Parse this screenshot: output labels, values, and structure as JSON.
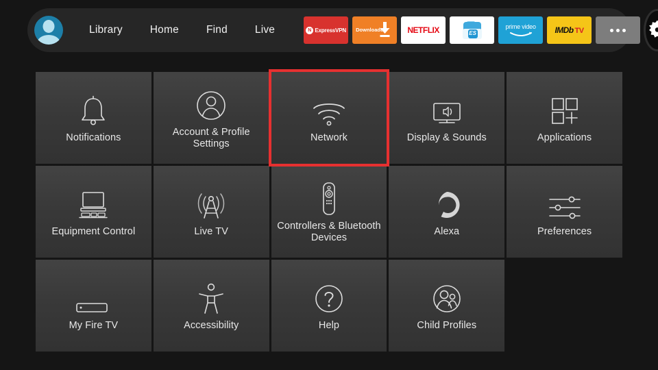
{
  "topbar": {
    "avatar_name": "profile-avatar",
    "nav": [
      {
        "label": "Library"
      },
      {
        "label": "Home"
      },
      {
        "label": "Find"
      },
      {
        "label": "Live"
      }
    ],
    "apps": [
      {
        "name": "expressvpn",
        "label": "ExpressVPN",
        "bg": "#d8322e"
      },
      {
        "name": "downloader",
        "label": "Downloader",
        "bg": "#f08026"
      },
      {
        "name": "netflix",
        "label": "NETFLIX",
        "bg": "#ffffff"
      },
      {
        "name": "es-file-explorer",
        "label": "ES",
        "bg": "#ffffff"
      },
      {
        "name": "prime-video",
        "label": "prime video",
        "bg": "#1fa2d6"
      },
      {
        "name": "imdb-tv",
        "label": "IMDb",
        "label2": "TV",
        "bg": "#f5c518"
      },
      {
        "name": "more-apps",
        "label": "•••",
        "bg": "#7d7d7d"
      }
    ],
    "settings_button": "settings-gear"
  },
  "grid": {
    "focused_index": 2,
    "focus_color": "#e63030",
    "tiles": [
      {
        "icon": "bell-icon",
        "label": "Notifications"
      },
      {
        "icon": "person-circle-icon",
        "label": "Account & Profile Settings"
      },
      {
        "icon": "wifi-icon",
        "label": "Network"
      },
      {
        "icon": "tv-speaker-icon",
        "label": "Display & Sounds"
      },
      {
        "icon": "apps-grid-plus-icon",
        "label": "Applications"
      },
      {
        "icon": "tv-equipment-icon",
        "label": "Equipment Control"
      },
      {
        "icon": "broadcast-tower-icon",
        "label": "Live TV"
      },
      {
        "icon": "remote-control-icon",
        "label": "Controllers & Bluetooth Devices"
      },
      {
        "icon": "alexa-ring-icon",
        "label": "Alexa"
      },
      {
        "icon": "sliders-icon",
        "label": "Preferences"
      },
      {
        "icon": "firetv-stick-icon",
        "label": "My Fire TV"
      },
      {
        "icon": "accessibility-person-icon",
        "label": "Accessibility"
      },
      {
        "icon": "question-circle-icon",
        "label": "Help"
      },
      {
        "icon": "child-profiles-icon",
        "label": "Child Profiles"
      }
    ]
  }
}
